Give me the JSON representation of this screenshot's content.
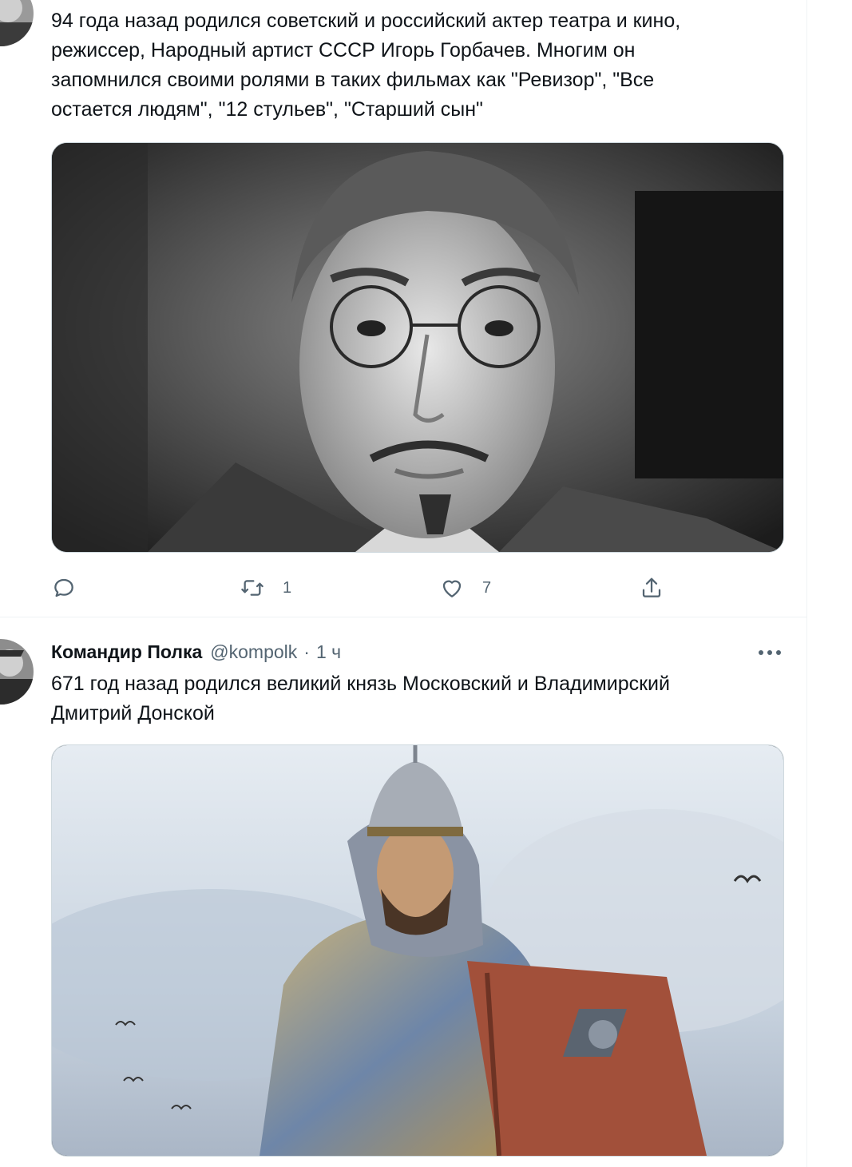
{
  "tweet1": {
    "text": "94 года назад родился советский и российский актер театра и кино,\nрежиссер, Народный артист СССР Игорь Горбачев. Многим он\nзапомнился своими ролями в таких фильмах как \"Ревизор\", \"Все\nостается людям\", \"12 стульев\", \"Старший сын\"",
    "actions": {
      "reply_icon": "reply-icon",
      "retweet_icon": "retweet-icon",
      "retweet_count": "1",
      "like_icon": "heart-icon",
      "like_count": "7",
      "share_icon": "share-icon"
    }
  },
  "tweet2": {
    "display_name": "Командир Полка",
    "handle": "@kompolk",
    "separator": "·",
    "time": "1 ч",
    "more_icon": "more-icon",
    "text": "671 год назад родился великий князь Московский и Владимирский\nДмитрий Донской"
  },
  "colors": {
    "text": "#0f1419",
    "secondary": "#536471",
    "border": "#cfd9de",
    "divider": "#eff3f4"
  }
}
